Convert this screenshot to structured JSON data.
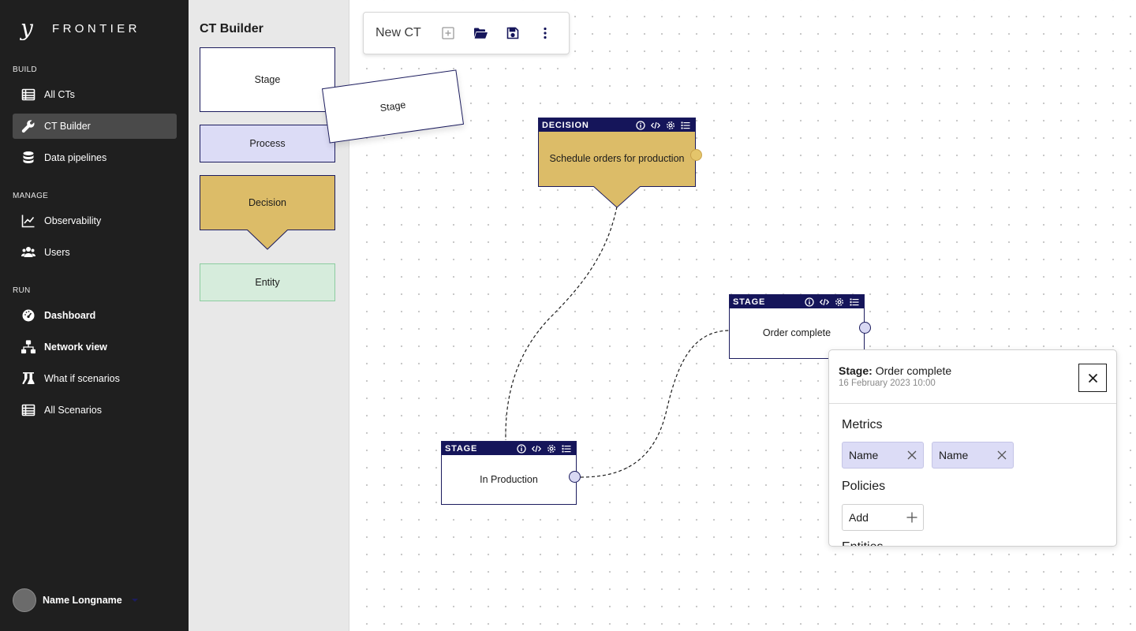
{
  "brand": {
    "mark": "y",
    "name": "FRONTIER"
  },
  "nav": {
    "sections": [
      {
        "label": "BUILD"
      },
      {
        "label": "MANAGE"
      },
      {
        "label": "RUN"
      }
    ],
    "items": [
      {
        "label": "All CTs",
        "icon": "table-icon"
      },
      {
        "label": "CT Builder",
        "icon": "wrench-icon",
        "active": true
      },
      {
        "label": "Data pipelines",
        "icon": "database-icon"
      },
      {
        "label": "Observability",
        "icon": "line-chart-icon"
      },
      {
        "label": "Users",
        "icon": "users-icon"
      },
      {
        "label": "Dashboard",
        "icon": "gauge-icon"
      },
      {
        "label": "Network view",
        "icon": "network-icon"
      },
      {
        "label": "What if scenarios",
        "icon": "flask-icon"
      },
      {
        "label": "All Scenarios",
        "icon": "table-icon"
      }
    ]
  },
  "user": {
    "name": "Name Longname"
  },
  "palette": {
    "title": "CT Builder",
    "blocks": [
      {
        "label": "Stage"
      },
      {
        "label": "Process"
      },
      {
        "label": "Decision"
      },
      {
        "label": "Entity"
      }
    ],
    "dragging": {
      "label": "Stage"
    }
  },
  "toolbar": {
    "title": "New CT"
  },
  "nodes": [
    {
      "type": "DECISION",
      "label": "Schedule orders for production"
    },
    {
      "type": "STAGE",
      "label": "Order complete"
    },
    {
      "type": "STAGE",
      "label": "In Production"
    }
  ],
  "panel": {
    "title_prefix": "Stage:",
    "title": "Order complete",
    "date": "16 February 2023 10:00",
    "metrics_label": "Metrics",
    "metrics": [
      {
        "label": "Name"
      },
      {
        "label": "Name"
      }
    ],
    "policies_label": "Policies",
    "add_label": "Add",
    "entities_label": "Entities"
  },
  "colors": {
    "sidebar": "#1f1f1f",
    "navy": "#15155a",
    "decision": "#dcbc68",
    "process": "#dcdcf6",
    "entity": "#d6ecdc"
  }
}
